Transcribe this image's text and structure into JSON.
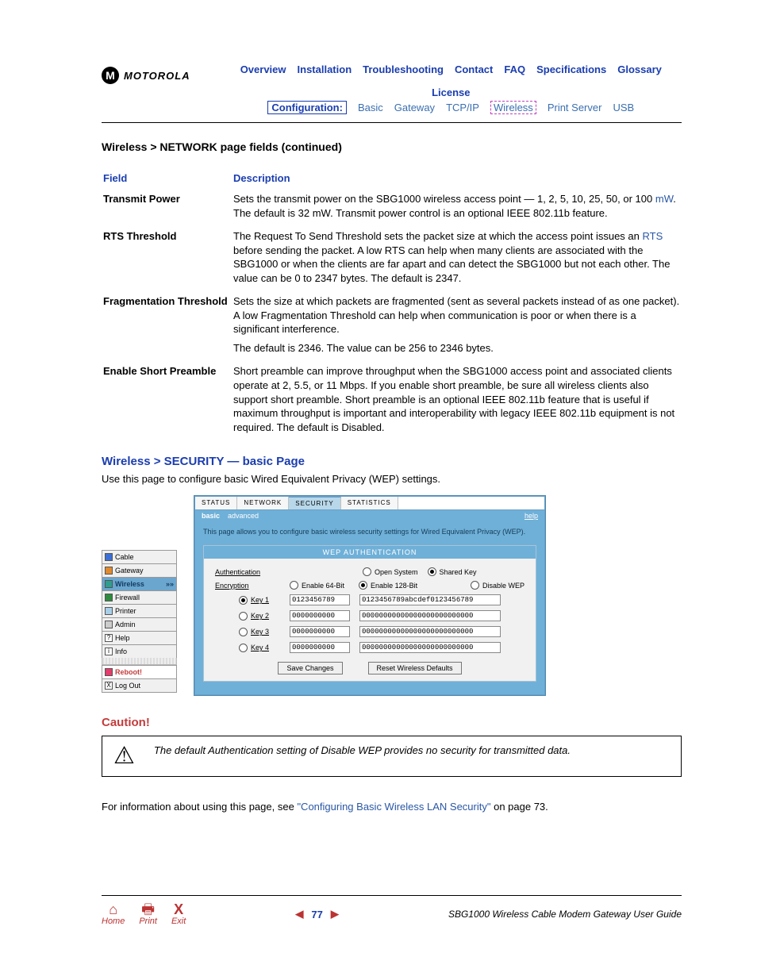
{
  "brand": "MOTOROLA",
  "topnav_row1": [
    "Overview",
    "Installation",
    "Troubleshooting",
    "Contact",
    "FAQ",
    "Specifications",
    "Glossary",
    "License"
  ],
  "topnav_row2": {
    "config_label": "Configuration:",
    "items": [
      "Basic",
      "Gateway",
      "TCP/IP",
      "Wireless",
      "Print Server",
      "USB"
    ]
  },
  "section_heading": "Wireless > NETWORK page fields (continued)",
  "table_headers": {
    "field": "Field",
    "desc": "Description"
  },
  "fields": [
    {
      "name": "Transmit Power",
      "desc_pre": "Sets the transmit power on the SBG1000 wireless access point — 1, 2, 5, 10, 25, 50, or 100 ",
      "link": "mW",
      "desc_post": ". The default is 32 mW. Transmit power control is an optional IEEE 802.11b feature."
    },
    {
      "name": "RTS Threshold",
      "desc_pre": "The Request To Send Threshold sets the packet size at which the access point issues an ",
      "link": "RTS",
      "desc_post": " before sending the packet. A low RTS can help when many clients are associated with the SBG1000 or when the clients are far apart and can detect the SBG1000 but not each other. The value can be 0 to 2347 bytes. The default is 2347."
    },
    {
      "name": "Fragmentation Threshold",
      "desc_pre": "Sets the size at which packets are fragmented (sent as several packets instead of as one packet). A low Fragmentation Threshold can help when communication is poor or when there is a significant interference.",
      "link": "",
      "desc_post": "",
      "extra": "The default is 2346. The value can be 256 to 2346 bytes."
    },
    {
      "name": "Enable Short Preamble",
      "desc_pre": "Short preamble can improve throughput when the SBG1000 access point and associated clients operate at 2, 5.5, or 11 Mbps. If you enable short preamble, be sure all wireless clients also support short preamble. Short preamble is an optional IEEE 802.11b feature that is useful if maximum throughput is important and interoperability with legacy IEEE 802.11b equipment is not required. The default is Disabled.",
      "link": "",
      "desc_post": ""
    }
  ],
  "sec_heading": "Wireless > SECURITY — basic Page",
  "sec_intro": "Use this page to configure basic Wired Equivalent Privacy (WEP) settings.",
  "sidebar": {
    "items": [
      {
        "label": "Cable",
        "cls": "blue"
      },
      {
        "label": "Gateway",
        "cls": "orange"
      },
      {
        "label": "Wireless",
        "cls": "teal",
        "active": true,
        "arrow": "»»"
      },
      {
        "label": "Firewall",
        "cls": "green"
      },
      {
        "label": "Printer",
        "cls": "ltblue"
      },
      {
        "label": "Admin",
        "cls": "gray"
      },
      {
        "label": "Help",
        "cls": "q",
        "glyph": "?"
      },
      {
        "label": "Info",
        "cls": "i",
        "glyph": "i"
      }
    ],
    "reboot": "Reboot!",
    "logout": "Log Out"
  },
  "panel": {
    "tabs": [
      "STATUS",
      "NETWORK",
      "SECURITY",
      "STATISTICS"
    ],
    "active_tab": 2,
    "subtabs": {
      "basic": "basic",
      "advanced": "advanced",
      "help": "help"
    },
    "intro": "This page allows you to configure basic wireless security settings for Wired Equivalent Privacy (WEP).",
    "wep_title": "WEP AUTHENTICATION",
    "auth_label": "Authentication",
    "auth_open": "Open System",
    "auth_shared": "Shared Key",
    "enc_label": "Encryption",
    "enc_64": "Enable 64-Bit",
    "enc_128": "Enable 128-Bit",
    "enc_disable": "Disable WEP",
    "keys": [
      {
        "label": "Key 1",
        "short": "0123456789",
        "long": "0123456789abcdef0123456789",
        "selected": true
      },
      {
        "label": "Key 2",
        "short": "0000000000",
        "long": "00000000000000000000000000"
      },
      {
        "label": "Key 3",
        "short": "0000000000",
        "long": "00000000000000000000000000"
      },
      {
        "label": "Key 4",
        "short": "0000000000",
        "long": "00000000000000000000000000"
      }
    ],
    "save_btn": "Save Changes",
    "reset_btn": "Reset Wireless Defaults"
  },
  "caution_heading": "Caution!",
  "caution_msg": "The default Authentication setting of Disable WEP provides no security for transmitted data.",
  "post_caution_pre": "For information about using this page, see ",
  "post_caution_link": "\"Configuring Basic Wireless LAN Security\"",
  "post_caution_post": " on page 73.",
  "footer": {
    "home": "Home",
    "print": "Print",
    "exit": "Exit",
    "page": "77",
    "guide": "SBG1000 Wireless Cable Modem Gateway User Guide"
  }
}
